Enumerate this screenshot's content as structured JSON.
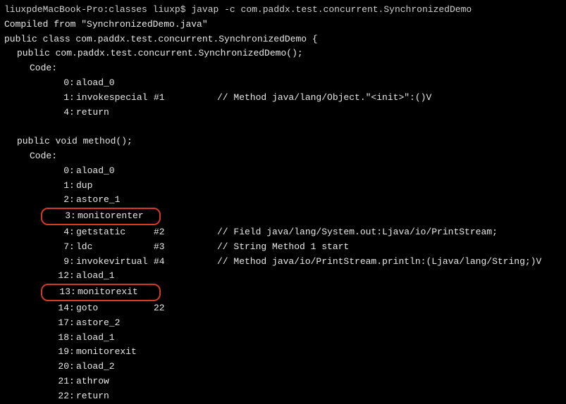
{
  "prompt": {
    "host": "liuxpdeMacBook-Pro",
    "path": "classes",
    "user": "liuxp",
    "dollar": "$",
    "command": "javap -c com.paddx.test.concurrent.SynchronizedDemo"
  },
  "compiled_from": "Compiled from \"SynchronizedDemo.java\"",
  "class_decl": "public class com.paddx.test.concurrent.SynchronizedDemo {",
  "ctor": {
    "signature": "public com.paddx.test.concurrent.SynchronizedDemo();",
    "code_label": "Code:",
    "instructions": [
      {
        "offset": "0",
        "op": "aload_0",
        "arg": "",
        "comment": ""
      },
      {
        "offset": "1",
        "op": "invokespecial",
        "arg": "#1",
        "comment": "// Method java/lang/Object.\"<init>\":()V"
      },
      {
        "offset": "4",
        "op": "return",
        "arg": "",
        "comment": ""
      }
    ]
  },
  "method": {
    "signature": "public void method();",
    "code_label": "Code:",
    "instructions": [
      {
        "offset": "0",
        "op": "aload_0",
        "arg": "",
        "comment": "",
        "hl": false
      },
      {
        "offset": "1",
        "op": "dup",
        "arg": "",
        "comment": "",
        "hl": false
      },
      {
        "offset": "2",
        "op": "astore_1",
        "arg": "",
        "comment": "",
        "hl": false
      },
      {
        "offset": "3",
        "op": "monitorenter",
        "arg": "",
        "comment": "",
        "hl": true
      },
      {
        "offset": "4",
        "op": "getstatic",
        "arg": "#2",
        "comment": "// Field java/lang/System.out:Ljava/io/PrintStream;",
        "hl": false
      },
      {
        "offset": "7",
        "op": "ldc",
        "arg": "#3",
        "comment": "// String Method 1 start",
        "hl": false
      },
      {
        "offset": "9",
        "op": "invokevirtual",
        "arg": "#4",
        "comment": "// Method java/io/PrintStream.println:(Ljava/lang/String;)V",
        "hl": false
      },
      {
        "offset": "12",
        "op": "aload_1",
        "arg": "",
        "comment": "",
        "hl": false
      },
      {
        "offset": "13",
        "op": "monitorexit",
        "arg": "",
        "comment": "",
        "hl": true
      },
      {
        "offset": "14",
        "op": "goto",
        "arg": "22",
        "comment": "",
        "hl": false
      },
      {
        "offset": "17",
        "op": "astore_2",
        "arg": "",
        "comment": "",
        "hl": false
      },
      {
        "offset": "18",
        "op": "aload_1",
        "arg": "",
        "comment": "",
        "hl": false
      },
      {
        "offset": "19",
        "op": "monitorexit",
        "arg": "",
        "comment": "",
        "hl": false
      },
      {
        "offset": "20",
        "op": "aload_2",
        "arg": "",
        "comment": "",
        "hl": false
      },
      {
        "offset": "21",
        "op": "athrow",
        "arg": "",
        "comment": "",
        "hl": false
      },
      {
        "offset": "22",
        "op": "return",
        "arg": "",
        "comment": "",
        "hl": false
      }
    ]
  }
}
